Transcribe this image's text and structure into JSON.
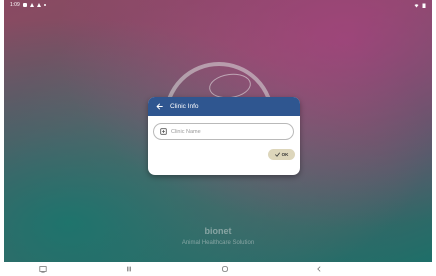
{
  "status_bar": {
    "time": "1:09",
    "icons": [
      "gallery-icon",
      "warning-icon",
      "warning-icon",
      "dot-icon"
    ],
    "right_icons": [
      "wifi-icon",
      "battery-icon"
    ]
  },
  "background": {
    "brand_name": "bionet",
    "brand_tagline": "Animal Healthcare Solution"
  },
  "dialog": {
    "title": "Clinic Info",
    "back_icon": "arrow-left-icon",
    "field_icon": "building-icon",
    "clinic_name": {
      "value": "",
      "placeholder": "Clinic Name"
    },
    "ok_label": "OK",
    "ok_icon": "checkmark-icon",
    "header_color": "#2f5690",
    "button_color": "#ddd6bb"
  },
  "nav_bar": {
    "buttons": [
      "screenshot-icon",
      "recent-apps-icon",
      "home-icon",
      "back-icon"
    ]
  }
}
